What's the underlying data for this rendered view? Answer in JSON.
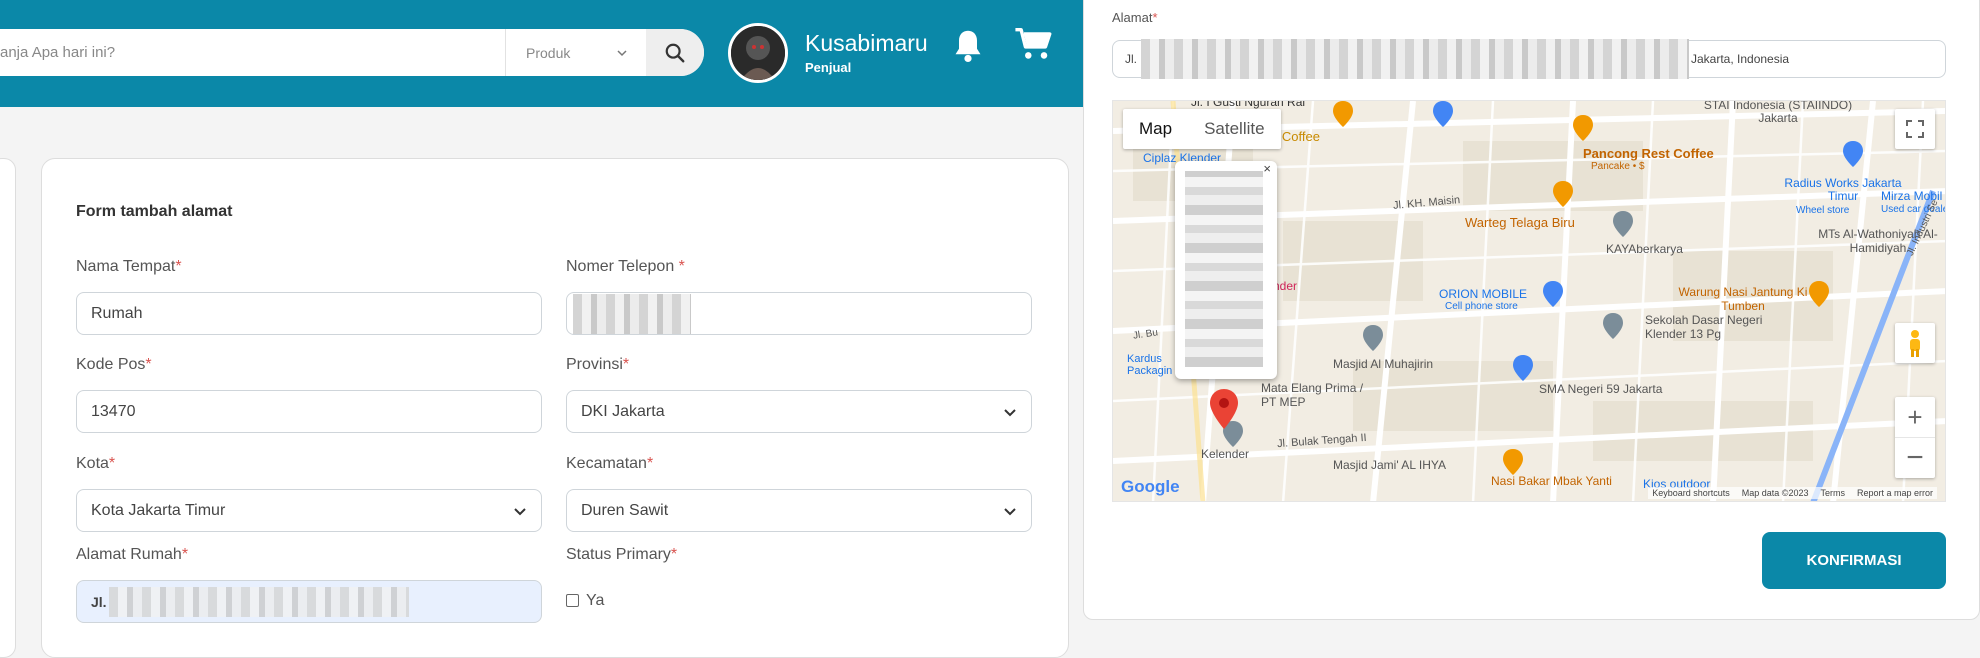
{
  "header": {
    "search_placeholder": "Belanja Apa hari ini?",
    "search_visible_text": "anja Apa hari ini?",
    "category": "Produk",
    "user_name": "Kusabimaru",
    "user_role": "Penjual"
  },
  "form": {
    "title": "Form tambah alamat",
    "nama_tempat": {
      "label": "Nama Tempat",
      "value": "Rumah"
    },
    "nomer_telepon": {
      "label": "Nomer Telepon "
    },
    "kode_pos": {
      "label": "Kode Pos",
      "value": "13470"
    },
    "provinsi": {
      "label": "Provinsi",
      "value": "DKI Jakarta"
    },
    "kota": {
      "label": "Kota",
      "value": "Kota Jakarta Timur"
    },
    "kecamatan": {
      "label": "Kecamatan",
      "value": "Duren Sawit"
    },
    "alamat_rumah": {
      "label": "Alamat Rumah",
      "value_prefix": "Jl."
    },
    "status_primary": {
      "label": "Status Primary",
      "option": "Ya",
      "checked": false
    }
  },
  "address_panel": {
    "label": "Alamat",
    "value_prefix": "Jl.",
    "value_suffix": "Jakarta, Indonesia"
  },
  "map": {
    "tabs": [
      "Map",
      "Satellite"
    ],
    "active_tab": "Map",
    "pois": [
      "Jl. I Gusti Ngurah Rai",
      "Pikir Coffee",
      "Ciplaz Klender",
      "STAI Indonesia (STAIINDO) Jakarta",
      "Pancong Rest Coffee",
      "Pancake • $",
      "Radius Works Jakarta Timur",
      "Wheel store",
      "Mirza Mobil",
      "Used car dealer",
      "Jl. KH. Maisin",
      "Warteg Telaga Biru",
      "MTs Al-Wathoniyah Al-Hamidiyah",
      "KAYAberkarya",
      "Jl. Industri Se",
      "ORION MOBILE",
      "Cell phone store",
      "Warung Nasi Jantung Ki Tumben",
      "Sekolah Dasar Negeri Klender 13 Pg",
      "Masjid Al Muhajirin",
      "Jl. Bu",
      "Kardus Packagin",
      "nder",
      "SMA Negeri 59 Jakarta",
      "Mata Elang Prima / PT MEP",
      "Jl. Bulak Tengah II",
      "Kelender",
      "Masjid Jami' AL IHYA",
      "Nasi Bakar Mbak Yanti",
      "Kios outdoor"
    ],
    "attribution": [
      "Keyboard shortcuts",
      "Map data ©2023",
      "Terms",
      "Report a map error"
    ],
    "logo": "Google"
  },
  "confirm_label": "KONFIRMASI",
  "colors": {
    "brand": "#0b88a8",
    "required": "#d9534f",
    "marker": "#ea4335"
  }
}
